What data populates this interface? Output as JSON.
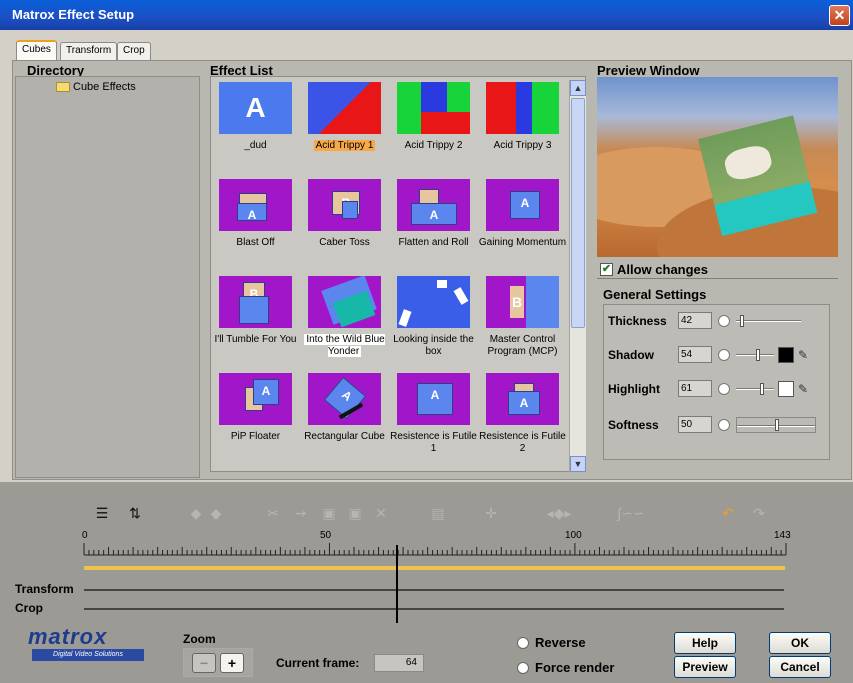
{
  "window": {
    "title": "Matrox Effect Setup",
    "close_glyph": "✕"
  },
  "tabs": [
    {
      "label": "Cubes"
    },
    {
      "label": "Transform"
    },
    {
      "label": "Crop"
    }
  ],
  "directory": {
    "title": "Directory",
    "item": "Cube Effects"
  },
  "effect_list": {
    "title": "Effect List",
    "items": [
      {
        "label": "_dud",
        "thumb_text": "A"
      },
      {
        "label": "Acid Trippy 1"
      },
      {
        "label": "Acid Trippy 2"
      },
      {
        "label": "Acid Trippy 3"
      },
      {
        "label": "Blast Off",
        "thumb_text": "A"
      },
      {
        "label": "Caber Toss",
        "thumb_text": "B"
      },
      {
        "label": "Flatten and Roll",
        "thumb_text": "A"
      },
      {
        "label": "Gaining Momentum",
        "thumb_text": "A"
      },
      {
        "label": "I'll Tumble For You",
        "thumb_text": "B"
      },
      {
        "label": "Into the Wild Blue Yonder"
      },
      {
        "label": "Looking inside the box"
      },
      {
        "label": "Master Control Program (MCP)",
        "thumb_text": "B"
      },
      {
        "label": "PiP Floater",
        "thumb_text": "A"
      },
      {
        "label": "Rectangular Cube",
        "thumb_text": "A"
      },
      {
        "label": "Resistence is Futile 1",
        "thumb_text": "A"
      },
      {
        "label": "Resistence is Futile 2",
        "thumb_text": "A"
      }
    ],
    "scroll_up": "▲",
    "scroll_down": "▼"
  },
  "preview": {
    "title": "Preview Window",
    "allow_changes": "Allow changes",
    "check_glyph": "✔"
  },
  "general": {
    "title": "General Settings",
    "thickness": {
      "label": "Thickness",
      "value": "42"
    },
    "shadow": {
      "label": "Shadow",
      "value": "54",
      "color": "#000000"
    },
    "highlight": {
      "label": "Highlight",
      "value": "61",
      "color": "#ffffff"
    },
    "softness": {
      "label": "Softness",
      "value": "50"
    },
    "picker_glyph": "✎"
  },
  "timeline": {
    "ruler": {
      "start": "0",
      "mid1": "50",
      "mid2": "100",
      "end": "143"
    },
    "transform_label": "Transform",
    "crop_label": "Crop"
  },
  "logo": {
    "name": "matrox",
    "tagline": "Digital Video Solutions"
  },
  "zoom": {
    "label": "Zoom",
    "minus": "−",
    "plus": "+"
  },
  "current_frame": {
    "label": "Current frame:",
    "value": "64"
  },
  "options": {
    "reverse": "Reverse",
    "force_render": "Force render"
  },
  "buttons": {
    "help": "Help",
    "ok": "OK",
    "preview": "Preview",
    "cancel": "Cancel"
  },
  "colors": {
    "accent_orange": "#f7a94a",
    "purple": "#a116c8",
    "blue_thumb": "#4b7aee",
    "titlebar": "#1c4fc4"
  }
}
